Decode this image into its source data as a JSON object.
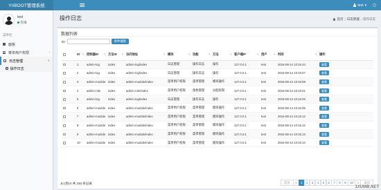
{
  "topbar": {
    "brand": "YIIBOOT管理系统",
    "user": "test",
    "caret": "▾"
  },
  "sidebar": {
    "profile_name": "test",
    "profile_status": "在线",
    "section_header": "菜单栏",
    "items": [
      {
        "label": "面板",
        "icon": "dashboard-icon"
      },
      {
        "label": "菜单用户权限",
        "icon": "menu-icon",
        "chevron": "‹"
      },
      {
        "label": "日志管理",
        "icon": "log-icon",
        "chevron": "∨"
      }
    ],
    "sub_items": [
      {
        "label": "操作日志",
        "icon": "circle-icon"
      }
    ]
  },
  "page": {
    "title": "操作日志",
    "breadcrumb": [
      "首页",
      "日志管理",
      "操作日志"
    ],
    "breadcrumb_sep": "/"
  },
  "box": {
    "title": "数据列表",
    "search_label": "ID:",
    "search_value": "",
    "search_button": "条件搜索"
  },
  "table": {
    "columns": [
      "",
      "ID",
      "控制器ID",
      "方法ID",
      "访问地址",
      "模块",
      "功能",
      "方法",
      "客户端IP",
      "用户",
      "时间",
      "操作"
    ],
    "sort_glyph": "⇅",
    "action_label": "查看",
    "rows": [
      [
        "1",
        "admin-log",
        "index",
        "admin-log/index",
        "日志管理",
        "操作日志",
        "操作",
        "127.0.0.1",
        "test",
        "2016-08-14 10:15:44"
      ],
      [
        "2",
        "admin-log",
        "index",
        "admin-log/index",
        "日志管理",
        "操作日志",
        "操作",
        "127.0.0.1",
        "test",
        "2016-08-14 10:15:47"
      ],
      [
        "3",
        "admin-module",
        "index",
        "admin-module/index",
        "菜单用户权限",
        "菜单管理",
        "模块操作",
        "127.0.0.1",
        "test",
        "2016-08-14 10:15:59"
      ],
      [
        "4",
        "admin-role",
        "index",
        "admin-role/index",
        "菜单用户权限",
        "角色管理",
        "分配权限",
        "127.0.0.1",
        "test",
        "2016-08-14 10:16:01"
      ],
      [
        "5",
        "admin-log",
        "index",
        "admin-log/index",
        "日志管理",
        "操作日志",
        "操作",
        "127.0.0.1",
        "test",
        "2016-08-14 10:16:03"
      ],
      [
        "6",
        "admin-module",
        "index",
        "admin-module/index",
        "菜单用户权限",
        "菜单管理",
        "模块操作",
        "127.0.0.1",
        "test",
        "2016-08-14 10:16:05"
      ],
      [
        "7",
        "admin-module",
        "index",
        "admin-module/index",
        "菜单用户权限",
        "菜单管理",
        "模块操作",
        "127.0.0.1",
        "test",
        "2016-08-14 10:16:12"
      ],
      [
        "8",
        "admin-module",
        "index",
        "admin-module/index",
        "菜单用户权限",
        "菜单管理",
        "模块操作",
        "127.0.0.1",
        "test",
        "2016-08-14 10:16:12"
      ],
      [
        "9",
        "admin-module",
        "index",
        "admin-module/index",
        "菜单用户权限",
        "菜单管理",
        "模块操作",
        "127.0.0.1",
        "test",
        "2016-08-14 10:16:13"
      ],
      [
        "10",
        "admin-module",
        "index",
        "admin-module/index",
        "菜单用户权限",
        "菜单管理",
        "模块操作",
        "127.0.0.1",
        "test",
        "2016-08-14 10:16:14"
      ]
    ]
  },
  "footer": {
    "info": "从1到10 共 330 条记录",
    "pagination": [
      "首页",
      "<",
      "1",
      "2",
      "3",
      "4",
      "5",
      "6",
      "7",
      "8",
      "9",
      "10",
      ">",
      "末页"
    ],
    "active_page": "1"
  },
  "watermark": "1XUMB.NET"
}
